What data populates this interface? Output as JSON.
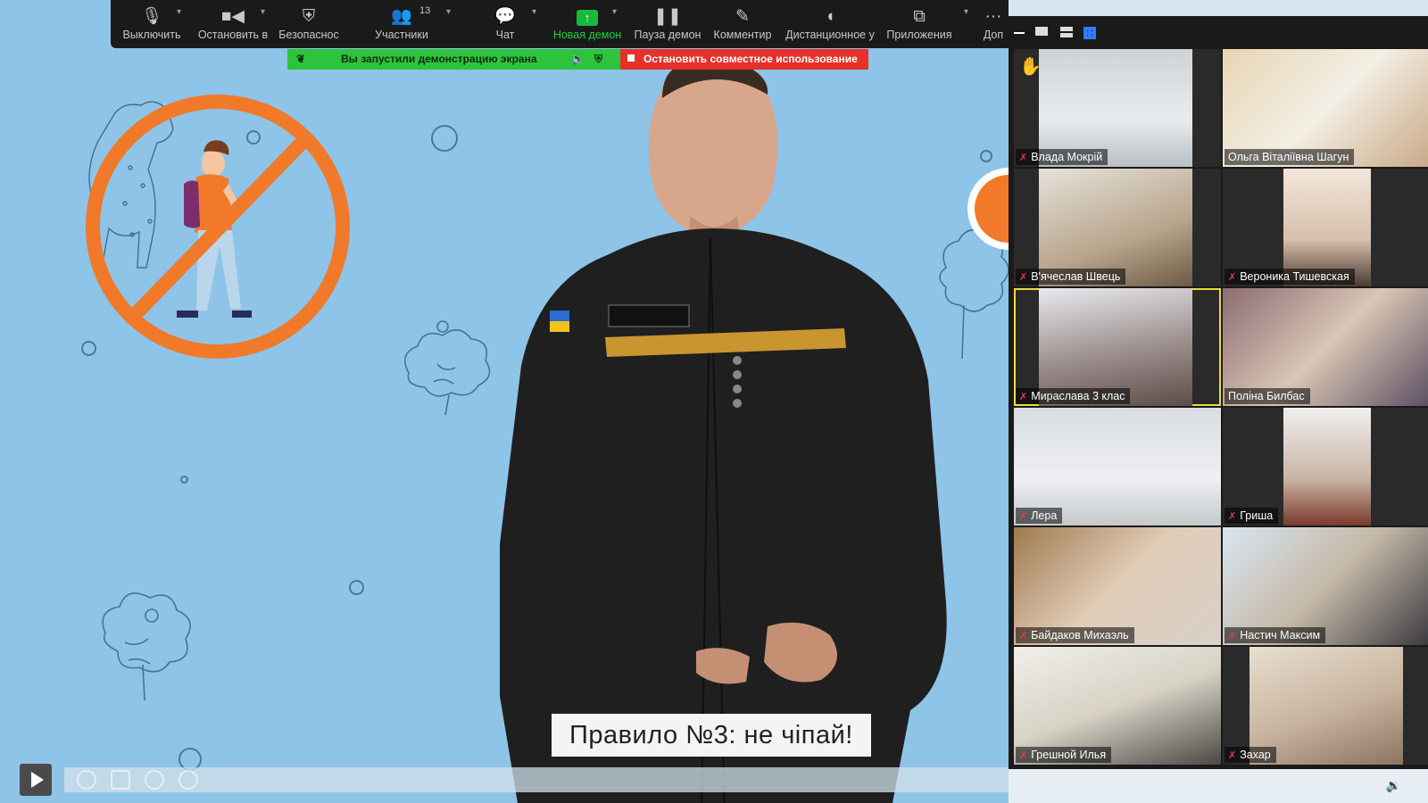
{
  "toolbar": {
    "mute": "Выключить",
    "stop_video": "Остановить в",
    "security": "Безопаснос",
    "participants": "Участники",
    "participants_count": "13",
    "chat": "Чат",
    "new_share": "Новая демон",
    "pause_share": "Пауза демон",
    "annotate": "Комментир",
    "remote_control": "Дистанционное у",
    "apps": "Приложения",
    "more": "Доп"
  },
  "banner": {
    "sharing_text": "Вы запустили демонстрацию экрана",
    "stop_sharing": "Остановить совместное использование"
  },
  "video": {
    "subtitle": "Правило №3: не чіпай!"
  },
  "participants": [
    {
      "name": "Влада Мокрій",
      "muted": true
    },
    {
      "name": "Ольга Віталіївна Шагун",
      "muted": false
    },
    {
      "name": "В'ячеслав Швець",
      "muted": true
    },
    {
      "name": "Вероника Тишевская",
      "muted": true
    },
    {
      "name": "Мираслава  3 клас",
      "muted": true,
      "active_speaker": true
    },
    {
      "name": "Поліна Билбас",
      "muted": false
    },
    {
      "name": "Лера",
      "muted": true
    },
    {
      "name": "Гриша",
      "muted": true
    },
    {
      "name": "Байдаков Михаэль",
      "muted": true
    },
    {
      "name": "Настич Максим",
      "muted": true
    },
    {
      "name": "Грешной Илья",
      "muted": true
    },
    {
      "name": "Захар",
      "muted": true
    }
  ],
  "colors": {
    "toolbar_bg": "#1a1a1a",
    "share_green": "#2ec33c",
    "stop_red": "#e8302a",
    "stage_blue": "#8ec4e8",
    "no_sign_orange": "#f07a2a",
    "active_speaker": "#e9dd3a"
  }
}
